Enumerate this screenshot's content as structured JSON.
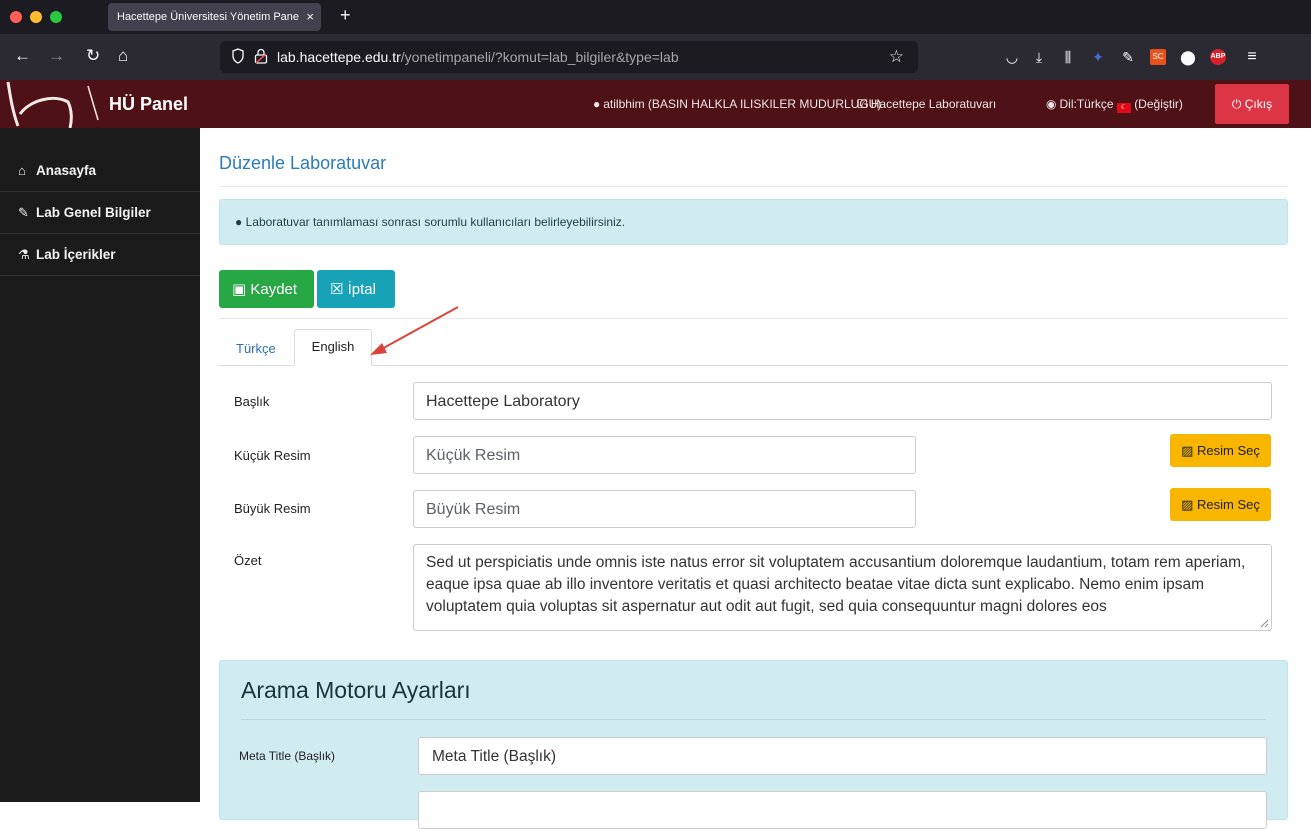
{
  "browser": {
    "tab_title": "Hacettepe Üniversitesi Yönetim Pane",
    "tab_close": "×",
    "new_tab": "+",
    "url_host": "lab.hacettepe.edu.tr",
    "url_path": "/yonetimpaneli/?komut=lab_bilgiler&type=lab"
  },
  "header": {
    "brand": "HÜ Panel",
    "user": "atilbhim (BASIN HALKLA ILISKILER MUDURLUGU)",
    "lab": "Hacettepe Laboratuvarı",
    "language": "Dil:Türkçe",
    "flag_text": "☾",
    "change_language": "(Değiştir)",
    "logout": "Çıkış"
  },
  "sidebar": {
    "items": [
      {
        "label": "Anasayfa",
        "icon": "home-icon"
      },
      {
        "label": "Lab Genel Bilgiler",
        "icon": "edit-icon"
      },
      {
        "label": "Lab İçerikler",
        "icon": "flask-icon"
      }
    ]
  },
  "main": {
    "title": "Düzenle Laboratuvar",
    "alert": "Laboratuvar tanımlaması sonrası sorumlu kullanıcıları belirleyebilirsiniz.",
    "save_label": "Kaydet",
    "cancel_label": "İptal",
    "tabs": [
      {
        "label": "Türkçe",
        "active": false
      },
      {
        "label": "English",
        "active": true
      }
    ],
    "form": {
      "title_label": "Başlık",
      "title_value": "Hacettepe Laboratory",
      "small_image_label": "Küçük Resim",
      "small_image_placeholder": "Küçük Resim",
      "large_image_label": "Büyük Resim",
      "large_image_placeholder": "Büyük Resim",
      "choose_image_label": "Resim Seç",
      "summary_label": "Özet",
      "summary_value": "Sed ut perspiciatis unde omnis iste natus error sit voluptatem accusantium doloremque laudantium, totam rem aperiam, eaque ipsa quae ab illo inventore veritatis et quasi architecto beatae vitae dicta sunt explicabo. Nemo enim ipsam voluptatem quia voluptas sit aspernatur aut odit aut fugit, sed quia consequuntur magni dolores eos"
    },
    "seo": {
      "title": "Arama Motoru Ayarları",
      "meta_title_label": "Meta Title (Başlık)",
      "meta_title_placeholder": "Meta Title (Başlık)"
    }
  },
  "colors": {
    "header_bg": "#4e1116",
    "sidebar_bg": "#1b1b1b",
    "save": "#28a745",
    "cancel": "#17a2b8",
    "logout": "#dc3545",
    "image_button": "#f9b600",
    "info_bg": "#d1ecf1"
  }
}
